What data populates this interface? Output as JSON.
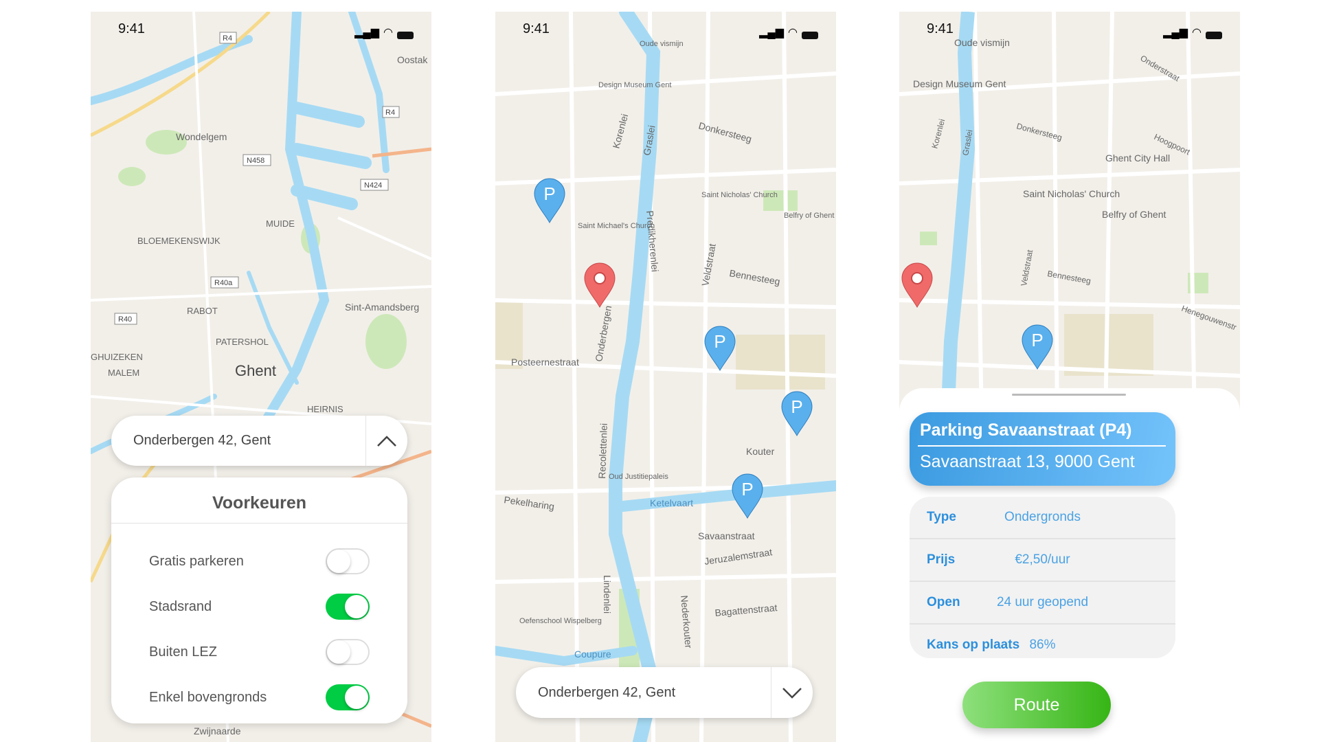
{
  "status_bar": {
    "time": "9:41"
  },
  "colors": {
    "water": "#a6daf4",
    "land": "#f2efe9",
    "park": "#cde8b8",
    "toggle_on": "#00cc44",
    "pin_blue": "#5ab0ec",
    "pin_red": "#f06a6a",
    "accent_blue": "#2c8fdc",
    "route_green": "#36b515"
  },
  "screen1": {
    "map_labels": [
      "Wondelgem",
      "MUIDE",
      "BLOEMEKENSWIJK",
      "RABOT",
      "Sint-Amandsberg",
      "PATERSHOL",
      "Ghent",
      "GHUIZEKEN",
      "MALEM",
      "HEIRNIS",
      "Oostak",
      "Zwijnaarde"
    ],
    "road_badges": [
      "R4",
      "R4",
      "N458",
      "N424",
      "R40a",
      "R40"
    ],
    "search": {
      "value": "Onderbergen 42, Gent",
      "icon": "chevron-up-icon"
    },
    "preferences": {
      "title": "Voorkeuren",
      "items": [
        {
          "label": "Gratis parkeren",
          "on": false
        },
        {
          "label": "Stadsrand",
          "on": true
        },
        {
          "label": "Buiten LEZ",
          "on": false
        },
        {
          "label": "Enkel bovengronds",
          "on": true
        }
      ]
    }
  },
  "screen2": {
    "map_labels": [
      "Oude vismijn",
      "Design Museum Gent",
      "Korenlei",
      "Graslei",
      "Donkersteeg",
      "Saint Nicholas' Church",
      "Saint Michael's Church",
      "Belfry of Ghent",
      "Predikherenlei",
      "Veldstraat",
      "Bennesteeg",
      "Onderbergen",
      "Posteernestraat",
      "Kouter",
      "Oud Justitiepaleis",
      "Ketelvaart",
      "Savaanstraat",
      "Jeruzalemstraat",
      "Pekelharing",
      "Bagattenstraat",
      "Coupure",
      "Oefenschool Wispelberg",
      "Nederkouter",
      "Recolettenlei",
      "Lindenlei"
    ],
    "search": {
      "value": "Onderbergen 42, Gent",
      "icon": "chevron-down-icon"
    },
    "pins": [
      {
        "type": "parking",
        "label": "P"
      },
      {
        "type": "location"
      },
      {
        "type": "parking",
        "label": "P"
      },
      {
        "type": "parking",
        "label": "P"
      },
      {
        "type": "parking",
        "label": "P"
      }
    ]
  },
  "screen3": {
    "map_labels": [
      "Oude vismijn",
      "Design Museum Gent",
      "Korenlei",
      "Graslei",
      "Donkersteeg",
      "Ghent City Hall",
      "Hoogpoort",
      "Saint Nicholas' Church",
      "Belfry of Ghent",
      "Bennesteeg",
      "Veldstraat",
      "Henegouwenstr",
      "Onderstraat"
    ],
    "pins": [
      {
        "type": "location"
      },
      {
        "type": "parking",
        "label": "P"
      }
    ],
    "parking": {
      "name": "Parking Savaanstraat (P4)",
      "address": "Savaanstraat 13, 9000 Gent",
      "details": [
        {
          "key": "Type",
          "value": "Ondergronds"
        },
        {
          "key": "Prijs",
          "value": "€2,50/uur"
        },
        {
          "key": "Open",
          "value": "24 uur geopend"
        },
        {
          "key": "Kans op plaats",
          "value": "86%"
        }
      ],
      "route_label": "Route"
    }
  }
}
